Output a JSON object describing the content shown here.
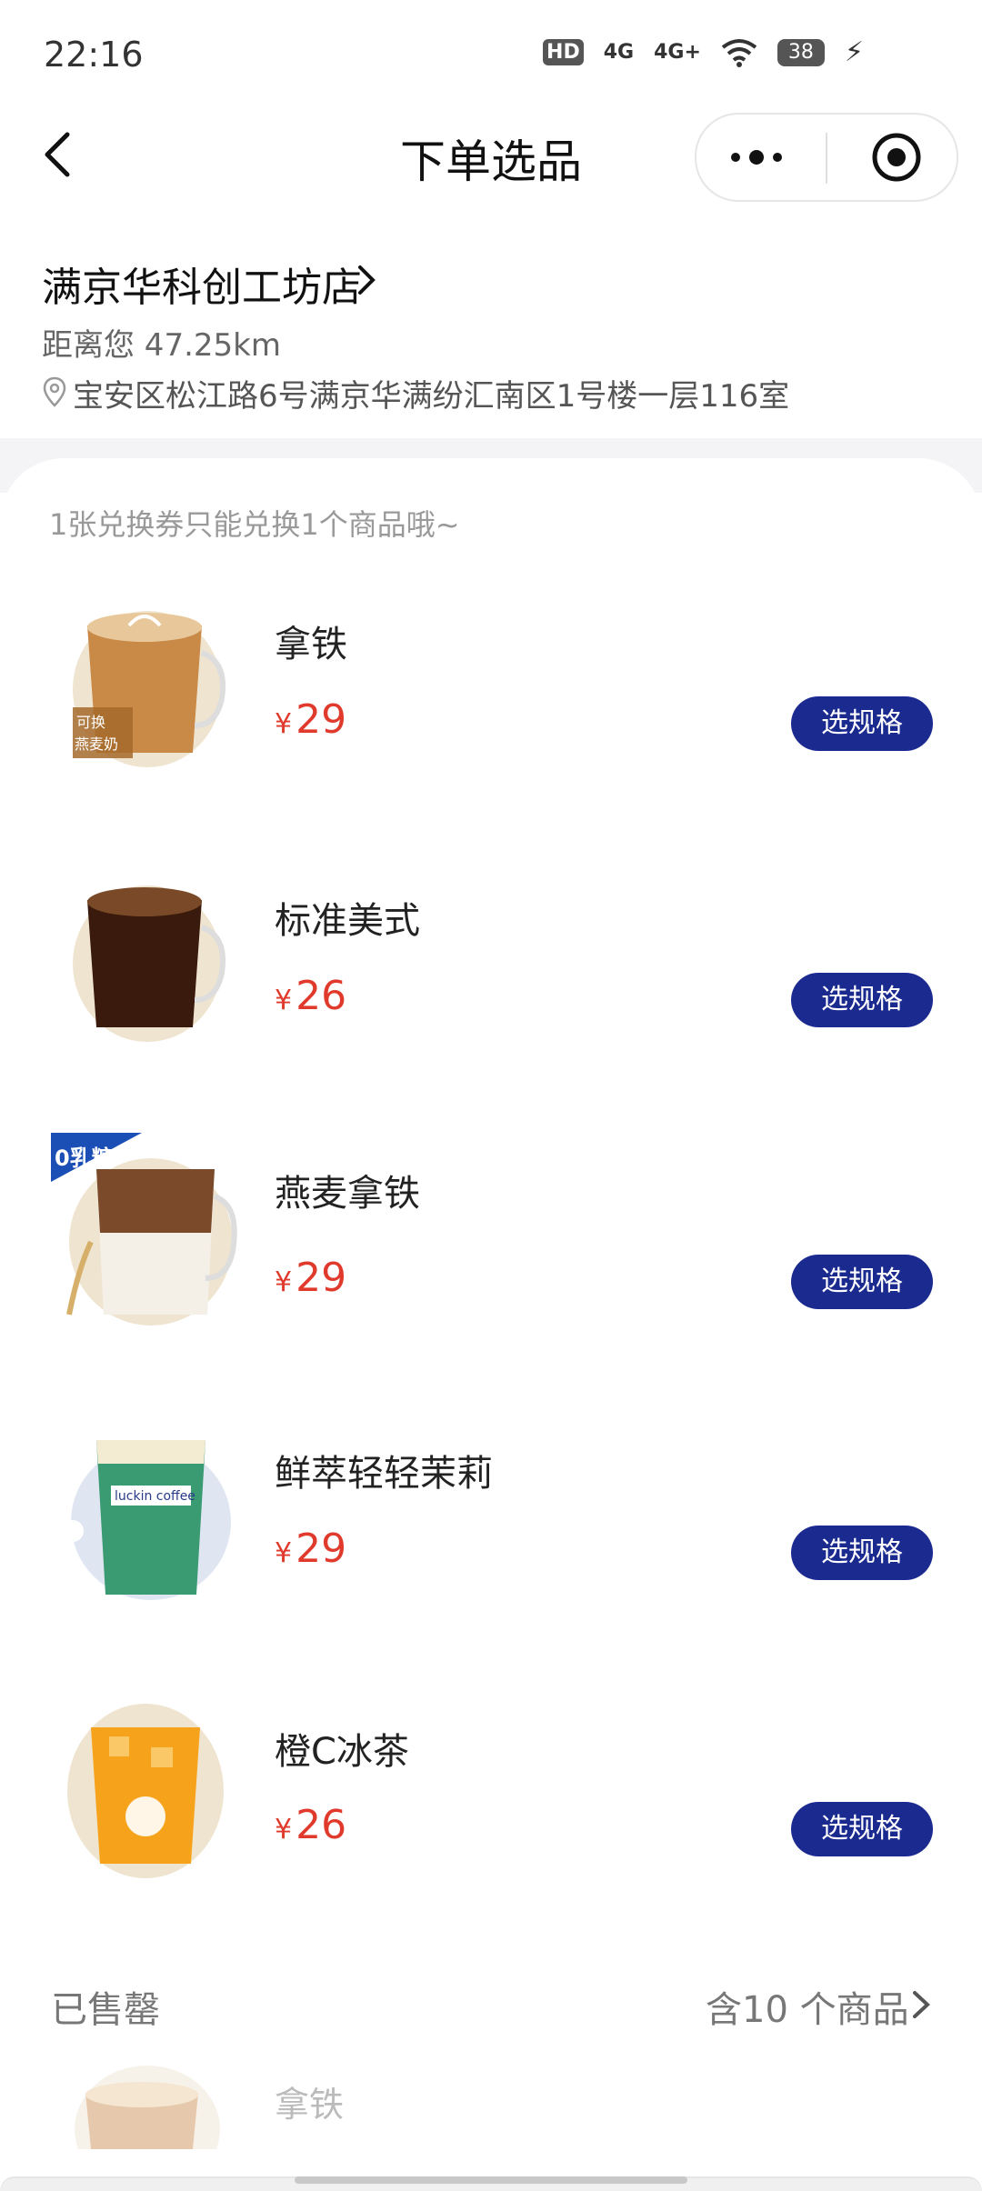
{
  "status_bar": {
    "time": "22:16",
    "icons": [
      "hd-icon",
      "signal-4g-icon",
      "signal-4g-plus-icon",
      "wifi-icon"
    ],
    "hd_label": "HD",
    "net1": "4G",
    "net2": "4G+",
    "battery": "38"
  },
  "nav": {
    "title": "下单选品"
  },
  "store": {
    "name": "满京华科创工坊店",
    "distance": "距离您 47.25km",
    "address": "宝安区松江路6号满京华满纷汇南区1号楼一层116室"
  },
  "notice": "1张兑换券只能兑换1个商品哦~",
  "currency": "¥",
  "products": [
    {
      "name": "拿铁",
      "price": "29",
      "badge": "可换燕麦奶",
      "button": "选规格"
    },
    {
      "name": "标准美式",
      "price": "26",
      "button": "选规格"
    },
    {
      "name": "燕麦拿铁",
      "price": "29",
      "badge": "0乳糖",
      "button": "选规格"
    },
    {
      "name": "鲜萃轻轻茉莉",
      "price": "29",
      "cup_text": "luckin coffee",
      "button": "选规格"
    },
    {
      "name": "橙C冰茶",
      "price": "26",
      "button": "选规格"
    }
  ],
  "sold_out": {
    "label": "已售罄",
    "count": "含10 个商品",
    "first_item": "拿铁"
  },
  "colors": {
    "accent_button": "#1a2a8f",
    "price_red": "#e03a2c"
  }
}
